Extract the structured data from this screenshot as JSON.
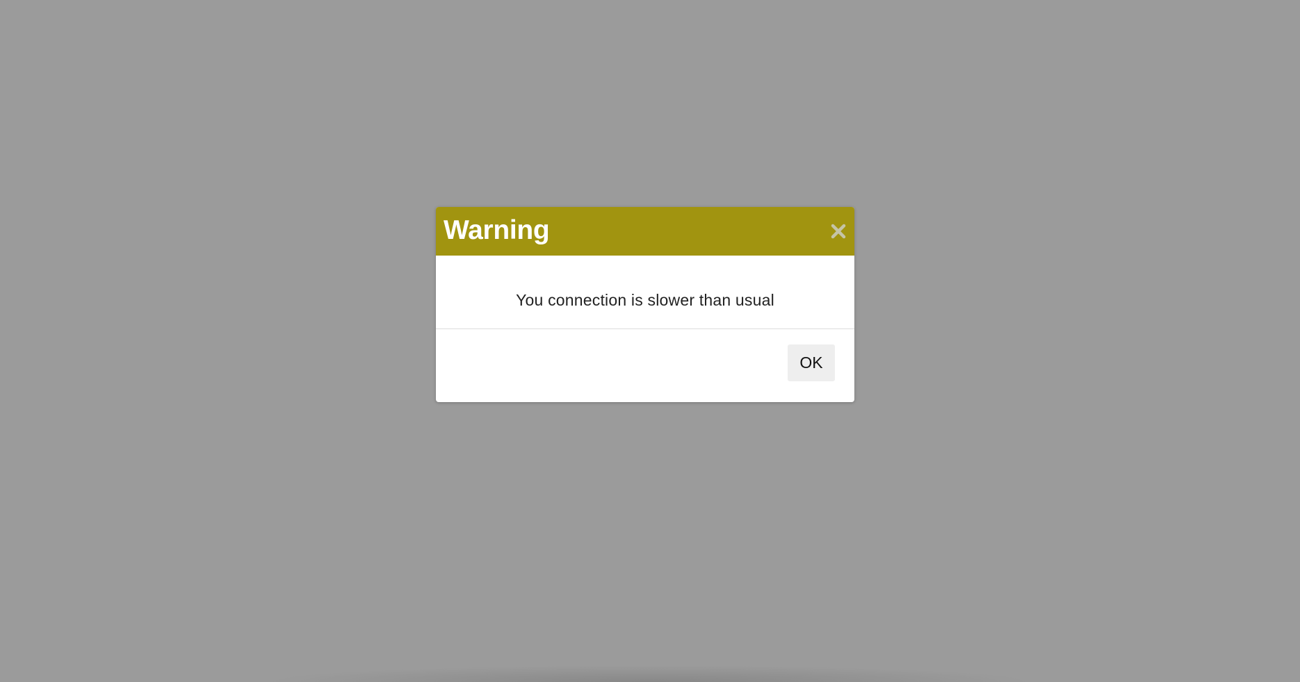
{
  "colors": {
    "backdrop": "#9b9b9b",
    "header_accent": "#a19410",
    "dialog_background": "#ffffff",
    "button_background": "#eeeeee"
  },
  "dialog": {
    "title": "Warning",
    "close_icon": "close-icon",
    "message": "You connection is slower than usual",
    "ok_label": "OK"
  }
}
